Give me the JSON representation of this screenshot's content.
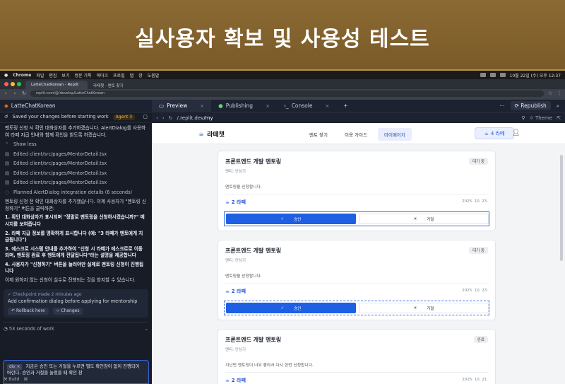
{
  "banner": {
    "title": "실사용자 확보 및 사용성 테스트"
  },
  "menubar": {
    "app": "Chrome",
    "items": [
      "파일",
      "편집",
      "보기",
      "방문 기록",
      "북마크",
      "프로필",
      "탭",
      "창",
      "도움말"
    ],
    "clock": "10월 22일 (수) 오후 12:37"
  },
  "chrome": {
    "tabs": [
      {
        "label": "LatteChatKorean - Replit"
      },
      {
        "label": "라떼챗 - 멘토 찾기"
      }
    ],
    "url": "replit.com/@/develop/LatteChatKorean"
  },
  "replit": {
    "project": "LatteChatKorean",
    "tabs": [
      {
        "label": "Preview"
      },
      {
        "label": "Publishing"
      },
      {
        "label": "Console"
      }
    ],
    "republish": "Republish"
  },
  "agent": {
    "saved": "Saved your changes before starting work",
    "badge": "Agent 3",
    "intro": "멘토링 신청 시 확인 대화상자를 추가하겠습니다. AlertDialog를 사용하여 라떼 지급 안내와 함께 확인을 받도록 하겠습니다.",
    "show_less": "Show less",
    "files": [
      "Edited client/src/pages/MentorDetail.tsx",
      "Edited client/src/pages/MentorDetail.tsx",
      "Edited client/src/pages/MentorDetail.tsx",
      "Edited client/src/pages/MentorDetail.tsx",
      "Planned AlertDialog integration details (6 seconds)"
    ],
    "summary": "멘토링 신청 전 확인 대화상자를 추가했습니다. 이제 사용자가 \"멘토링 신청하기\" 버튼을 클릭하면:",
    "list": [
      "1. 확인 대화상자가 표시되며 \"정말로 멘토링을 신청하시겠습니까?\" 메시지를 보여줍니다",
      "2. 라떼 지급 정보를 명확하게 표시합니다 (예: \"3 라떼가 멘토에게 지급됩니다\")",
      "3. 에스크로 시스템 안내를 추가하여 \"신청 시 라떼가 에스크로로 이동되며, 멘토링 완료 후 멘토에게 전달됩니다\"라는 설명을 제공합니다",
      "4. 사용자가 \"신청하기\" 버튼을 눌러야만 실제로 멘토링 신청이 진행됩니다"
    ],
    "closing": "이제 원하지 않는 신청이 실수로 진행되는 것을 방지할 수 있습니다.",
    "checkpoint_meta": "Checkpoint made 2 minutes ago",
    "checkpoint_title": "Add confirmation dialog before applying for mentorship",
    "rollback": "Rollback here",
    "changes": "Changes",
    "work": "53 seconds of work",
    "input_chip": "div",
    "input_text": "지금은 승인 또는 거절을 누르면 별도 확인창이 없이 진행되어 버린다. 승인과 거절을 눌렀을 때 확인 창",
    "build": "Build"
  },
  "preview": {
    "url_prefix": "/",
    "url_host": ".replit.dev",
    "url_path": "/my",
    "theme": "Theme",
    "site": {
      "logo": "라떼챗",
      "links": [
        {
          "label": "멘토 찾기"
        },
        {
          "label": "이용 가이드"
        },
        {
          "label": "마이페이지"
        }
      ],
      "lamme": "4 라떼"
    },
    "cards": [
      {
        "title": "프론트엔드 개발 멘토링",
        "sub": "멘티: 인싱기",
        "badge": "대기 중",
        "body": "멘토링을 신청합니다.",
        "lamme": "2 라떼",
        "date": "2025. 10. 23.",
        "approve": "승인",
        "reject": "거절"
      },
      {
        "title": "프론트엔드 개발 멘토링",
        "sub": "멘티: 인싱기",
        "badge": "대기 중",
        "body": "멘토링을 신청합니다.",
        "lamme": "2 라떼",
        "date": "2025. 10. 23.",
        "approve": "승인",
        "reject": "거절"
      },
      {
        "title": "프론트엔드 개발 멘토링",
        "sub": "멘티: 인싱기",
        "badge": "완료",
        "body": "지난번 멘토링이 너무 좋아서 다시 한번 신청합니다.",
        "lamme": "2 라떼",
        "date": "2025. 10. 21."
      }
    ]
  }
}
